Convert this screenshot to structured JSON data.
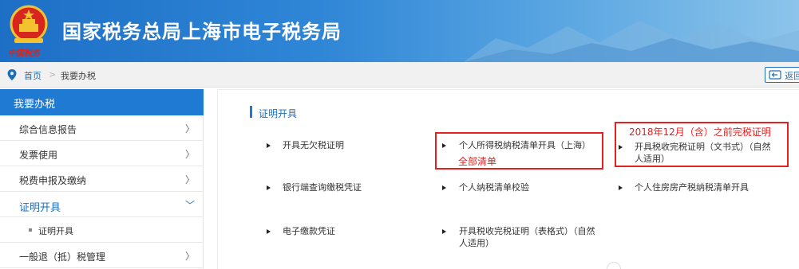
{
  "header": {
    "title": "国家税务总局上海市电子税务局",
    "emblem_caption": "中国税务"
  },
  "breadcrumb": {
    "home": "首页",
    "separator": ">",
    "current": "我要办税",
    "back_label": "返回"
  },
  "sidebar": {
    "heading": "我要办税",
    "items": [
      {
        "label": "综合信息报告",
        "chevron": "〉"
      },
      {
        "label": "发票使用",
        "chevron": "〉"
      },
      {
        "label": "税费申报及缴纳",
        "chevron": "〉"
      },
      {
        "label": "证明开具",
        "chevron": "﹀"
      },
      {
        "label": "证明开具"
      },
      {
        "label": "一般退（抵）税管理",
        "chevron": "〉"
      }
    ]
  },
  "main": {
    "section_title": "证明开具",
    "links": [
      {
        "line1": "开具无欠税证明"
      },
      {
        "line1": "个人所得税纳税清单开具（上海）"
      },
      {
        "line1": "开具税收完税证明（文书式）（自然",
        "line2": "人适用）"
      },
      {
        "line1": "银行端查询缴税凭证"
      },
      {
        "line1": "个人纳税清单校验"
      },
      {
        "line1": "个人住房房产税纳税清单开具"
      },
      {
        "line1": "电子缴款凭证"
      },
      {
        "line1": "开具税收完税证明（表格式）（自然",
        "line2": "人适用）"
      }
    ],
    "annotations": {
      "full_list": "全部清单",
      "before_2018": "2018年12月（含）之前完税证明"
    }
  },
  "colors": {
    "brand_blue": "#1f7ad4",
    "link_blue": "#1f6fb8",
    "annotation_red": "#e3211f"
  },
  "icons": [
    "national-emblem-icon",
    "location-pin-icon",
    "back-arrow-icon",
    "chevron-right-icon",
    "chevron-down-icon",
    "triangle-bullet-icon"
  ]
}
